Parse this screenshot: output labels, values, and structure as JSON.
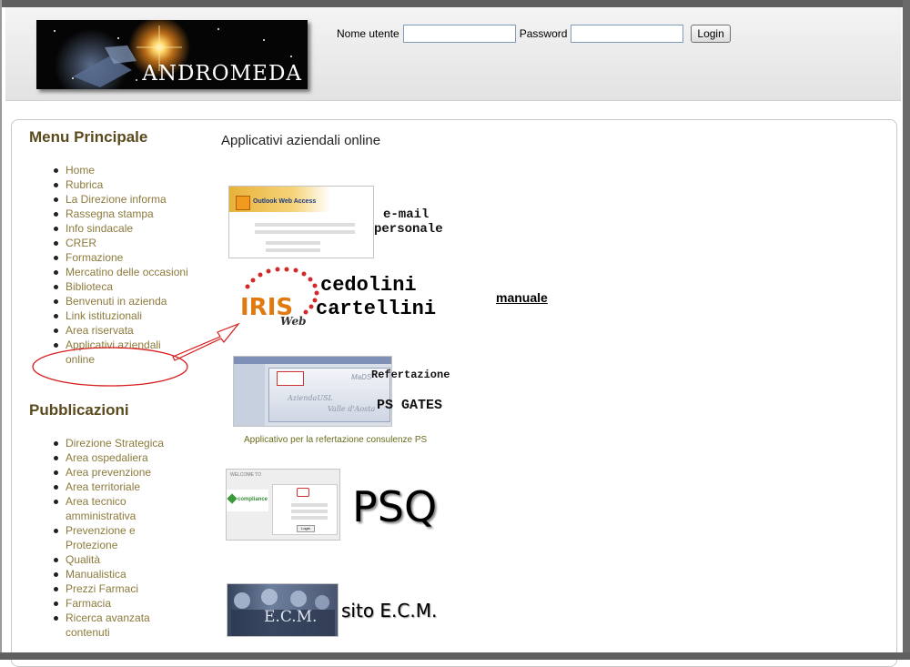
{
  "header": {
    "logo_text": "ANDROMEDA",
    "login": {
      "username_label": "Nome utente",
      "username_value": "",
      "password_label": "Password",
      "password_value": "",
      "login_button": "Login"
    }
  },
  "sidebar": {
    "menu_title": "Menu Principale",
    "menu_items": [
      {
        "label": "Home"
      },
      {
        "label": "Rubrica"
      },
      {
        "label": "La Direzione informa"
      },
      {
        "label": "Rassegna stampa"
      },
      {
        "label": "Info sindacale"
      },
      {
        "label": "CRER"
      },
      {
        "label": "Formazione"
      },
      {
        "label": "Mercatino delle occasioni"
      },
      {
        "label": "Biblioteca"
      },
      {
        "label": "Benvenuti in azienda"
      },
      {
        "label": "Link istituzionali"
      },
      {
        "label": "Area riservata"
      },
      {
        "label": "Applicativi aziendali online"
      }
    ],
    "pubs_title": "Pubblicazioni",
    "pub_items": [
      {
        "label": "Direzione Strategica"
      },
      {
        "label": "Area ospedaliera"
      },
      {
        "label": "Area prevenzione"
      },
      {
        "label": "Area territoriale"
      },
      {
        "label": "Area tecnico amministrativa"
      },
      {
        "label": "Prevenzione e Protezione"
      },
      {
        "label": "Qualità"
      },
      {
        "label": "Manualistica"
      },
      {
        "label": "Prezzi Farmaci"
      },
      {
        "label": "Farmacia"
      },
      {
        "label": "Ricerca avanzata contenuti"
      }
    ]
  },
  "main": {
    "title": "Applicativi aziendali online",
    "owa": {
      "thumb_title": "Outlook Web Access",
      "label_line1": "e-mail",
      "label_line2": "personale"
    },
    "iris": {
      "logo_text": "IRIS",
      "logo_sub": "Web",
      "label_line1": "cedolini",
      "label_line2": "cartellini",
      "manual_link": "manuale"
    },
    "ps": {
      "thumb_text1": "MaDS",
      "thumb_text2": "AziendaUSL",
      "thumb_text3": "Valle d'Aosta",
      "label_line1": "Refertazione",
      "label_line2": "PS GATES",
      "caption": "Applicativo per la refertazione consulenze PS"
    },
    "psq": {
      "thumb_welcome": "WELCOME TO",
      "thumb_brand": "compliance",
      "thumb_button": "Login",
      "label": "PSQ"
    },
    "ecm": {
      "thumb_text": "E.C.M.",
      "label": "sito E.C.M."
    }
  },
  "colors": {
    "menu_link": "#8c7a3b",
    "section_title": "#5a4a1e",
    "annotation": "#d81c1c"
  }
}
